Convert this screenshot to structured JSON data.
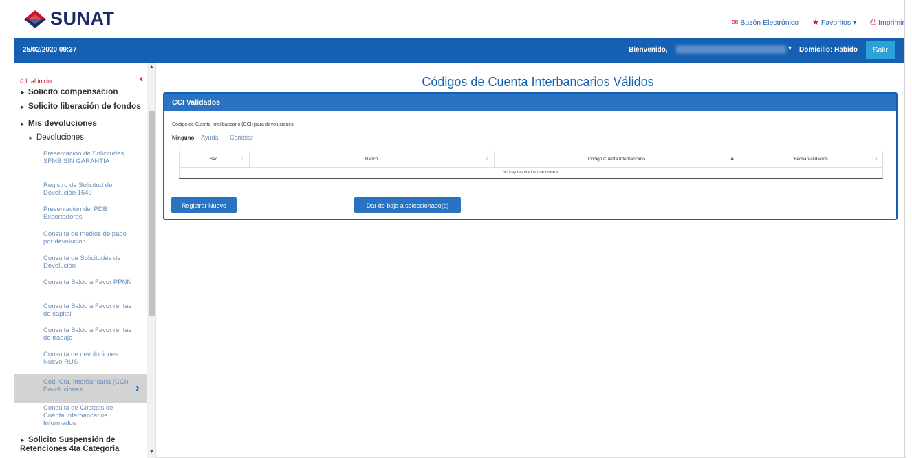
{
  "header": {
    "logo_text": "SUNAT",
    "links": [
      {
        "icon": "envelope-icon",
        "label": "Buzón Electrónico"
      },
      {
        "icon": "star-icon",
        "label": "Favoritos ▾"
      },
      {
        "icon": "printer-icon",
        "label": "Imprimir"
      }
    ]
  },
  "bluebar": {
    "datetime": "25/02/2020 09:37",
    "welcome": "Bienvenido,",
    "domicilio": "Domicilio: Habido",
    "salir": "Salir"
  },
  "sidebar": {
    "home": "Ir al inicio",
    "items": [
      {
        "label": "Solicito compensación"
      },
      {
        "label": "Solicito liberación de fondos"
      },
      {
        "label": "Mis devoluciones"
      },
      {
        "label": "Devoluciones"
      },
      {
        "label": "Presentación de Solicitudes SFMB SIN GARANTIA"
      },
      {
        "label": "Registro de Solicitud de Devolución 1649"
      },
      {
        "label": "Presentación del PDB Exportadores"
      },
      {
        "label": "Consulta de medios de pago por devolución"
      },
      {
        "label": "Consulta de Solicitudes de Devolución"
      },
      {
        "label": "Consulta Saldo a Favor PPNN"
      },
      {
        "label": "Consulta Saldo a Favor rentas de capital"
      },
      {
        "label": "Consulta Saldo a Favor rentas de trabajo"
      },
      {
        "label": "Consulta de devoluciones Nuevo RUS"
      },
      {
        "label": "Cod. Cta. Interbancaria (CCI) - Devoluciones"
      },
      {
        "label": "Consulta de Códigos de Cuenta Interbancarios Informados"
      },
      {
        "label": "Solicito Suspensión de Retenciones 4ta Categoria"
      }
    ]
  },
  "main": {
    "title": "Códigos de Cuenta Interbancarios Válidos",
    "panel_title": "CCI Validados",
    "subtitle": "Código de Cuenta Interbancario (CCI) para devoluciones:",
    "ninguno": "Ninguno",
    "ayuda": "Ayuda",
    "cambiar": "Cambiar",
    "table": {
      "columns": [
        "Sec.",
        "Banco",
        "Código Cuenta Interbancario",
        "Fecha Validación"
      ],
      "empty": "No hay resultados que mostrar"
    },
    "btn_registrar": "Registrar Nuevo",
    "btn_baja": "Dar de baja a seleccionado(s)"
  },
  "colors": {
    "brand_blue": "#1560b3",
    "brand_red": "#c9122c",
    "logo_navy": "#1f2b66"
  }
}
